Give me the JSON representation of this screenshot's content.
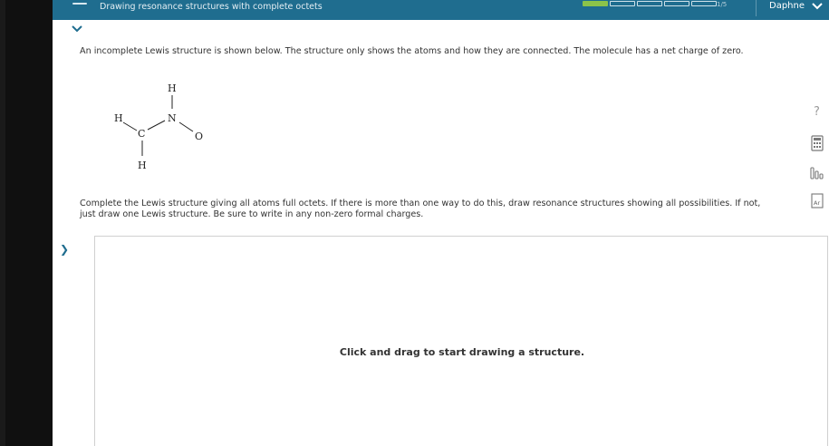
{
  "header": {
    "topic_title": "Drawing resonance structures with complete octets",
    "progress": {
      "filled": 1,
      "total": 5,
      "label": "1/5"
    },
    "user_name": "Daphne"
  },
  "question": {
    "intro": "An incomplete Lewis structure is shown below. The structure only shows the atoms and how they are connected. The molecule has a net charge of zero.",
    "instructions": "Complete the Lewis structure giving all atoms full octets. If there is more than one way to do this, draw resonance structures showing all possibilities. If not, just draw one Lewis structure. Be sure to write in any non-zero formal charges."
  },
  "molecule": {
    "atoms": {
      "h_top": "H",
      "n": "N",
      "h_left": "H",
      "c": "C",
      "o": "O",
      "h_bottom": "H"
    }
  },
  "drawing_area": {
    "prompt": "Click and drag to start drawing a structure."
  },
  "tools": {
    "help_glyph": "?",
    "periodic_glyph": "Ar"
  },
  "colors": {
    "header_bg": "#1f6d8f",
    "progress_fill": "#8bc34a",
    "accent": "#1f6d8f"
  },
  "icons": {
    "menu": "menu-icon",
    "user_dropdown": "chevron-down-icon",
    "collapse": "chevron-down-icon",
    "side": "chevron-right-icon",
    "help": "question-icon",
    "calculator": "calculator-icon",
    "chart": "bar-chart-icon",
    "periodic": "periodic-table-icon"
  }
}
